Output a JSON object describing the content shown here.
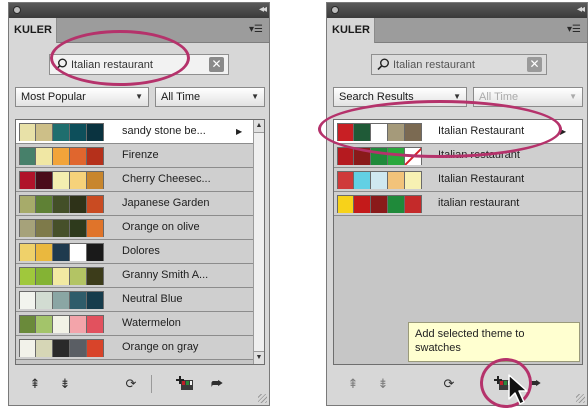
{
  "left": {
    "title": "KULER",
    "search_value": "Italian restaurant",
    "dropdown1": "Most Popular",
    "dropdown2": "All Time",
    "themes": [
      {
        "label": "sandy stone be...",
        "colors": [
          "#e8e1a8",
          "#cdbf88",
          "#1f6e6e",
          "#0d4f5b",
          "#0a3340"
        ],
        "selected": true,
        "arrow": true
      },
      {
        "label": "Firenze",
        "colors": [
          "#47806a",
          "#f0e7a4",
          "#f2a43a",
          "#e0662e",
          "#b5301b"
        ]
      },
      {
        "label": "Cherry Cheesec...",
        "colors": [
          "#b0132a",
          "#4a0c1a",
          "#f3eeb0",
          "#f6d27a",
          "#c8862d"
        ]
      },
      {
        "label": "Japanese Garden",
        "colors": [
          "#a7ab6a",
          "#5f8135",
          "#434f28",
          "#2e3218",
          "#c94b22"
        ]
      },
      {
        "label": "Orange on olive",
        "colors": [
          "#a6a27a",
          "#7e7a4a",
          "#46502a",
          "#2e3a1c",
          "#e0742a"
        ]
      },
      {
        "label": "Dolores",
        "colors": [
          "#efd16a",
          "#eab83e",
          "#1f3a4e",
          "#ffffff",
          "#1a1a1a"
        ]
      },
      {
        "label": "Granny Smith A...",
        "colors": [
          "#a0c83c",
          "#84b334",
          "#f2e9a2",
          "#b3c464",
          "#3c3c1a"
        ]
      },
      {
        "label": "Neutral Blue",
        "colors": [
          "#f2f4ee",
          "#d2dcd2",
          "#8aa6a4",
          "#2f5c6a",
          "#163c4c"
        ]
      },
      {
        "label": "Watermelon",
        "colors": [
          "#6a8a3a",
          "#a3c46a",
          "#f2f2e6",
          "#f3a4aa",
          "#e2515e"
        ]
      },
      {
        "label": "Orange on gray",
        "colors": [
          "#f2f2ea",
          "#d6d6b6",
          "#2a2a2a",
          "#5a5e64",
          "#d8442a"
        ]
      }
    ]
  },
  "right": {
    "title": "KULER",
    "search_value": "Italian restaurant",
    "dropdown1": "Search Results",
    "dropdown2": "All Time",
    "themes": [
      {
        "label": "Italian Restaurant",
        "colors": [
          "#c81f24",
          "#1f5a37",
          "#ffffff",
          "#a59a7a",
          "#7b6a52"
        ],
        "selected": true,
        "arrow": true
      },
      {
        "label": "Italian restaurant",
        "colors": [
          "#b51a1f",
          "#8a1a1a",
          "#1f8a3a",
          "#2aa83c",
          "#ffffff"
        ],
        "slash": true
      },
      {
        "label": "Italian Restaurant",
        "colors": [
          "#cf3a3a",
          "#62d0e4",
          "#cfe8f0",
          "#f2c37a",
          "#f7f1b3"
        ]
      },
      {
        "label": "italian restaurant",
        "colors": [
          "#f7d21a",
          "#c41a1a",
          "#8a1a1a",
          "#1f8a3a",
          "#c42a2a"
        ]
      }
    ],
    "tooltip": "Add selected theme to swatches"
  }
}
